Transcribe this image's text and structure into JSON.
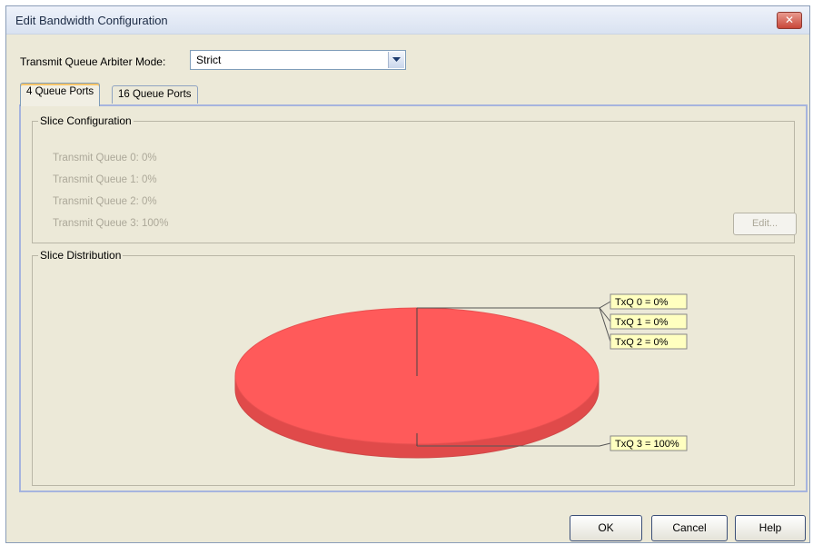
{
  "window": {
    "title": "Edit Bandwidth Configuration",
    "close_glyph": "✕"
  },
  "arbiter": {
    "label": "Transmit Queue Arbiter Mode:",
    "value": "Strict"
  },
  "tabs": [
    {
      "label": "4 Queue Ports",
      "active": true
    },
    {
      "label": "16 Queue Ports",
      "active": false
    }
  ],
  "slice_configuration": {
    "title": "Slice Configuration",
    "queues": [
      "Transmit Queue 0:  0%",
      "Transmit Queue 1:  0%",
      "Transmit Queue 2:  0%",
      "Transmit Queue 3:  100%"
    ],
    "edit_label": "Edit..."
  },
  "slice_distribution": {
    "title": "Slice Distribution"
  },
  "chart_data": {
    "type": "pie",
    "labels": [
      "TxQ 0 = 0%",
      "TxQ 1 = 0%",
      "TxQ 2 = 0%",
      "TxQ 3 = 100%"
    ],
    "categories": [
      "TxQ 0",
      "TxQ 1",
      "TxQ 2",
      "TxQ 3"
    ],
    "values": [
      0,
      0,
      0,
      100
    ],
    "colors": {
      "slice": "#ff5a5a",
      "slice_side": "#e04a4a",
      "label_bg": "#ffffc0"
    }
  },
  "footer": {
    "ok_label": "OK",
    "cancel_label": "Cancel",
    "help_label": "Help"
  }
}
